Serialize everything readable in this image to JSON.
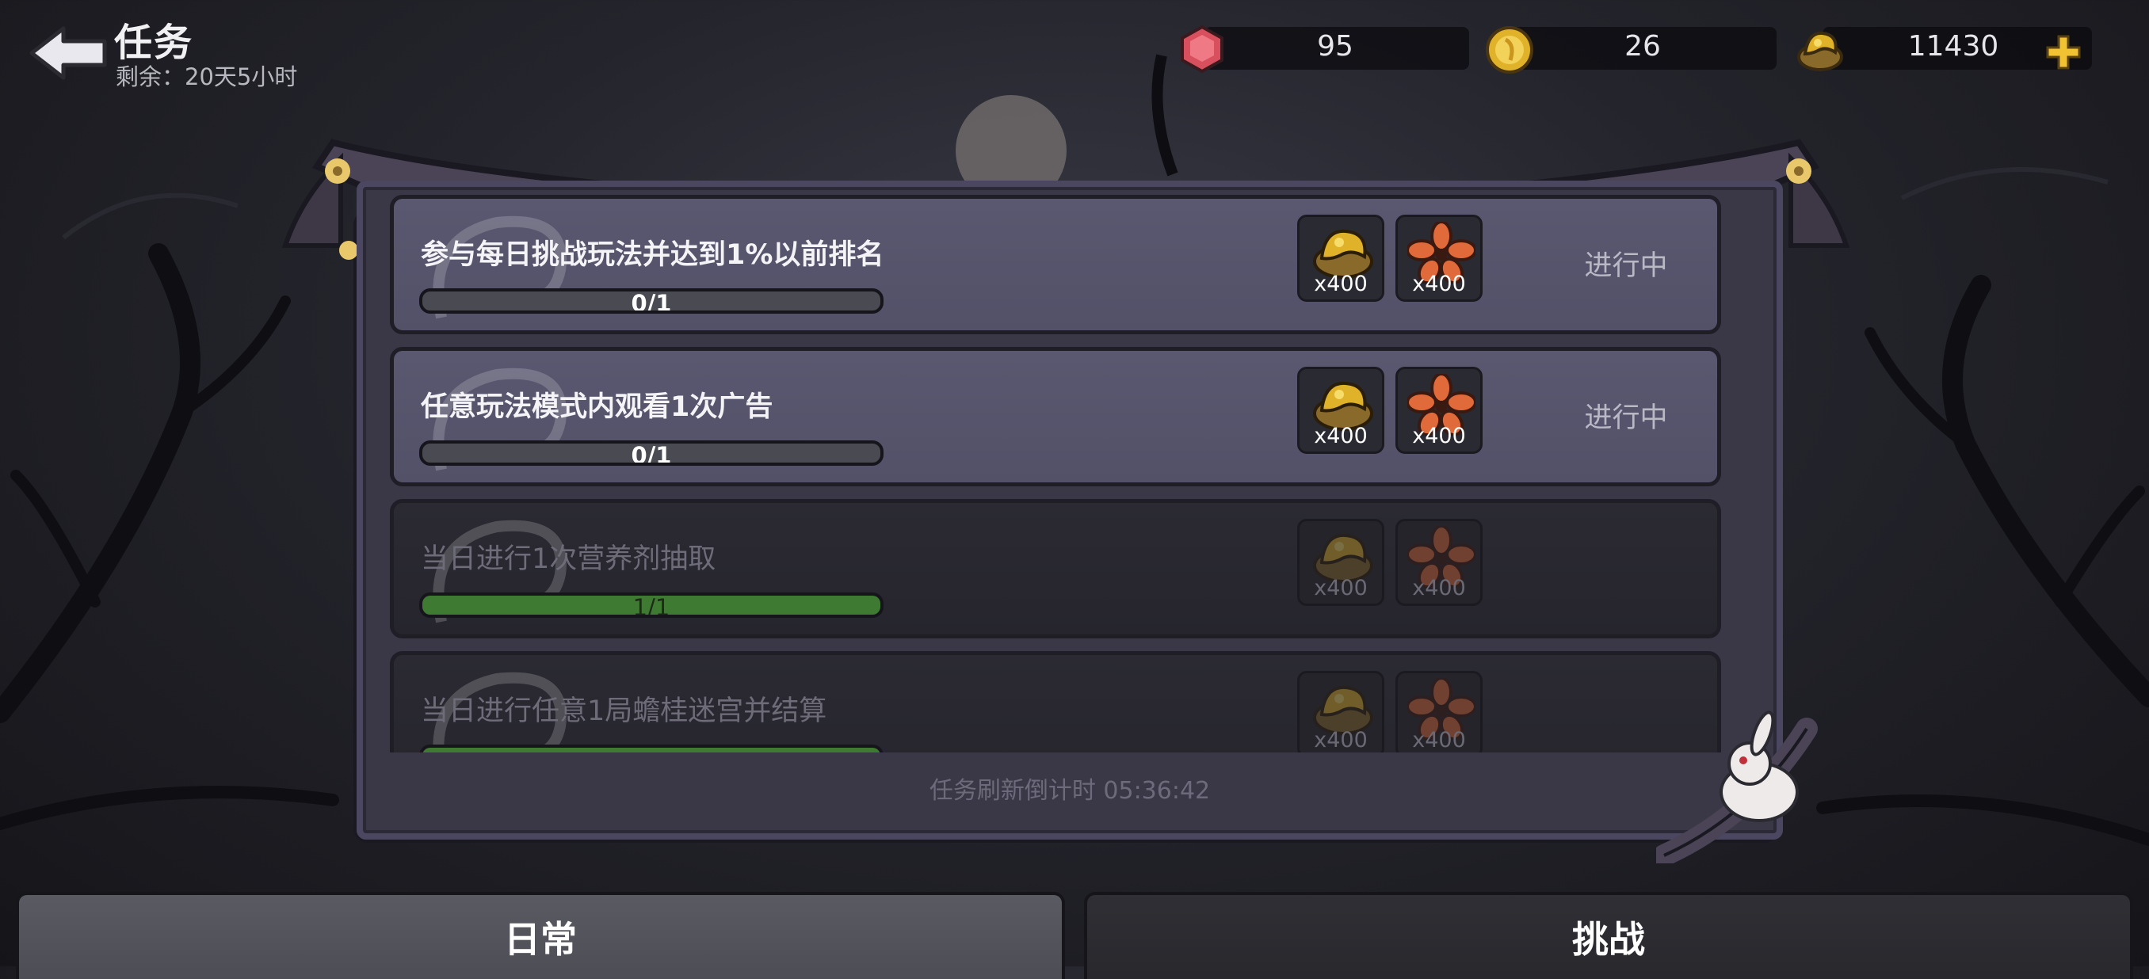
{
  "header": {
    "title": "任务",
    "remaining": "剩余：20天5小时"
  },
  "currencies": [
    {
      "icon": "red-gem-icon",
      "value": "95"
    },
    {
      "icon": "gold-coin-icon",
      "value": "26"
    },
    {
      "icon": "gold-ore-icon",
      "value": "11430"
    }
  ],
  "tasks": [
    {
      "name": "参与每日挑战玩法并达到1%以前排名",
      "progress_text": "0/1",
      "progress": 0,
      "rewards": [
        {
          "icon": "gold-ore-icon",
          "qty": "x400"
        },
        {
          "icon": "orange-flower-icon",
          "qty": "x400"
        }
      ],
      "status": "进行中",
      "completed": false
    },
    {
      "name": "任意玩法模式内观看1次广告",
      "progress_text": "0/1",
      "progress": 0,
      "rewards": [
        {
          "icon": "gold-ore-icon",
          "qty": "x400"
        },
        {
          "icon": "orange-flower-icon",
          "qty": "x400"
        }
      ],
      "status": "进行中",
      "completed": false
    },
    {
      "name": "当日进行1次营养剂抽取",
      "progress_text": "1/1",
      "progress": 1,
      "rewards": [
        {
          "icon": "gold-ore-icon",
          "qty": "x400"
        },
        {
          "icon": "orange-flower-icon",
          "qty": "x400"
        }
      ],
      "status": "",
      "completed": true
    },
    {
      "name": "当日进行任意1局蟾桂迷宫并结算",
      "progress_text": "",
      "progress": 1,
      "rewards": [
        {
          "icon": "gold-ore-icon",
          "qty": "x400"
        },
        {
          "icon": "orange-flower-icon",
          "qty": "x400"
        }
      ],
      "status": "",
      "completed": true
    }
  ],
  "refresh_text": "任务刷新倒计时 05:36:42",
  "tabs": [
    {
      "label": "日常",
      "active": true
    },
    {
      "label": "挑战",
      "active": false
    }
  ],
  "colors": {
    "background": "#24242c",
    "panel": "#3a3847",
    "task_active": "#5a5870",
    "task_done": "#2b2a33",
    "progress_fill": "#3f7a32",
    "gem_red": "#d8505e",
    "gold": "#e0b22a",
    "flower_orange": "#e06a3a"
  }
}
